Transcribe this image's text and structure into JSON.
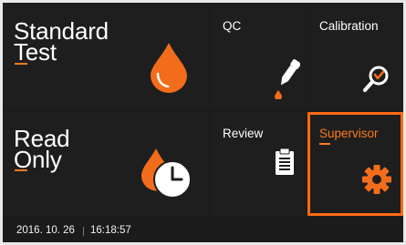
{
  "tiles": {
    "standard_test": {
      "label": "Standard\nTest",
      "icon": "drop-icon"
    },
    "qc": {
      "label": "QC",
      "icon": "dropper-icon"
    },
    "calibration": {
      "label": "Calibration",
      "icon": "magnifier-check-icon"
    },
    "read_only": {
      "label": "Read\nOnly",
      "icon": "drop-clock-icon"
    },
    "review": {
      "label": "Review",
      "icon": "clipboard-icon"
    },
    "supervisor": {
      "label": "Supervisor",
      "icon": "gear-icon",
      "selected": true
    }
  },
  "status": {
    "date": "2016. 10. 26",
    "time": "16:18:57"
  },
  "colors": {
    "accent": "#ff7a1a",
    "tile_bg": "#1e1e1e",
    "background": "#1b1b1b",
    "text": "#ffffff"
  }
}
